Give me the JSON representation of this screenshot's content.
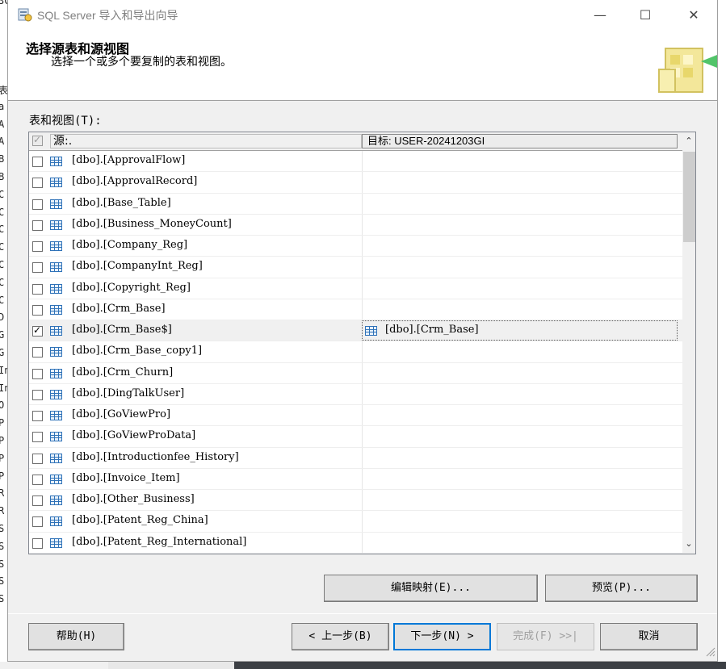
{
  "background_app": {
    "strip_letters": [
      "3C",
      "",
      "",
      "",
      "",
      "表",
      "a",
      "A",
      "A",
      "B",
      "B",
      "C",
      "C",
      "C",
      "C",
      "C",
      "C",
      "C",
      "D",
      "G",
      "G",
      "In",
      "In",
      "O",
      "P",
      "P",
      "P",
      "P",
      "R",
      "R",
      "S",
      "S",
      "S",
      "S",
      "S"
    ]
  },
  "window": {
    "title": "SQL Server 导入和导出向导",
    "minimize": "—",
    "maximize": "☐",
    "close": "✕"
  },
  "header": {
    "title": "选择源表和源视图",
    "subtitle": "选择一个或多个要复制的表和视图。"
  },
  "tables_label": "表和视图(T):",
  "grid": {
    "header_source": "源:.",
    "header_destination": "目标: USER-20241203GI",
    "rows": [
      {
        "source": "[dbo].[ApprovalFlow]",
        "checked": false,
        "destination": ""
      },
      {
        "source": "[dbo].[ApprovalRecord]",
        "checked": false,
        "destination": ""
      },
      {
        "source": "[dbo].[Base_Table]",
        "checked": false,
        "destination": ""
      },
      {
        "source": "[dbo].[Business_MoneyCount]",
        "checked": false,
        "destination": ""
      },
      {
        "source": "[dbo].[Company_Reg]",
        "checked": false,
        "destination": ""
      },
      {
        "source": "[dbo].[CompanyInt_Reg]",
        "checked": false,
        "destination": ""
      },
      {
        "source": "[dbo].[Copyright_Reg]",
        "checked": false,
        "destination": ""
      },
      {
        "source": "[dbo].[Crm_Base]",
        "checked": false,
        "destination": ""
      },
      {
        "source": "[dbo].[Crm_Base$]",
        "checked": true,
        "destination": "[dbo].[Crm_Base]"
      },
      {
        "source": "[dbo].[Crm_Base_copy1]",
        "checked": false,
        "destination": ""
      },
      {
        "source": "[dbo].[Crm_Churn]",
        "checked": false,
        "destination": ""
      },
      {
        "source": "[dbo].[DingTalkUser]",
        "checked": false,
        "destination": ""
      },
      {
        "source": "[dbo].[GoViewPro]",
        "checked": false,
        "destination": ""
      },
      {
        "source": "[dbo].[GoViewProData]",
        "checked": false,
        "destination": ""
      },
      {
        "source": "[dbo].[Introductionfee_History]",
        "checked": false,
        "destination": ""
      },
      {
        "source": "[dbo].[Invoice_Item]",
        "checked": false,
        "destination": ""
      },
      {
        "source": "[dbo].[Other_Business]",
        "checked": false,
        "destination": ""
      },
      {
        "source": "[dbo].[Patent_Reg_China]",
        "checked": false,
        "destination": ""
      },
      {
        "source": "[dbo].[Patent_Reg_International]",
        "checked": false,
        "destination": ""
      }
    ],
    "scroll_up": "⌃",
    "scroll_down": "⌄"
  },
  "buttons": {
    "edit_mappings": "编辑映射(E)...",
    "preview": "预览(P)...",
    "help": "帮助(H)",
    "back": "< 上一步(B)",
    "next": "下一步(N) >",
    "finish": "完成(F) >>|",
    "cancel": "取消"
  },
  "colors": {
    "accent": "#0078d7",
    "dialog_bg": "#f0f0f0",
    "table_icon": "#2f72b8"
  }
}
